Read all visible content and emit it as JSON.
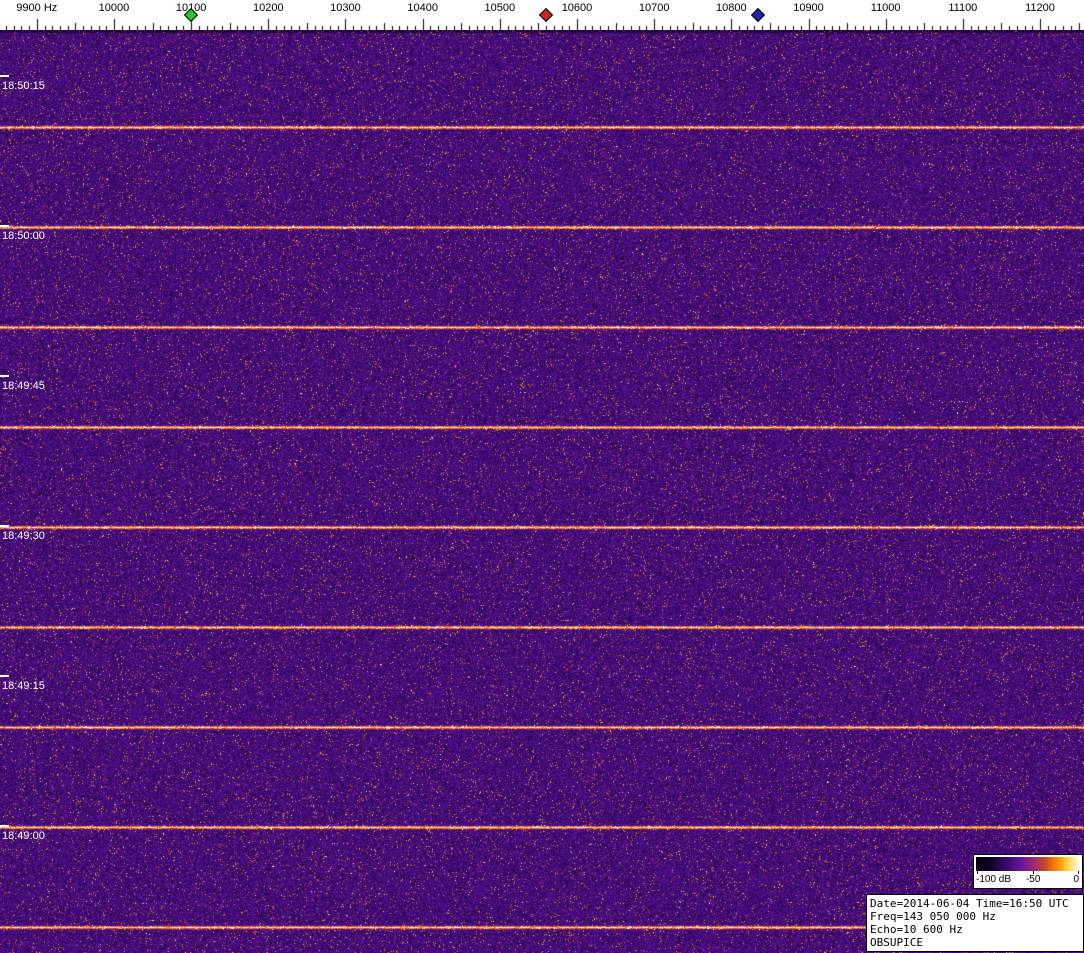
{
  "chart_data": {
    "type": "heatmap",
    "description": "Radio meteor observation waterfall spectrogram: purple broadband noise with bright full-bandwidth pulse lines repeating every 10 seconds",
    "x_axis": {
      "unit": "Hz",
      "tick_labels": [
        "9900 Hz",
        "10000",
        "10100",
        "10200",
        "10300",
        "10400",
        "10500",
        "10600",
        "10700",
        "10800",
        "10900",
        "11000",
        "11100",
        "11200"
      ],
      "tick_freqs": [
        9900,
        10000,
        10100,
        10200,
        10300,
        10400,
        10500,
        10600,
        10700,
        10800,
        10900,
        11000,
        11100,
        11200
      ],
      "minor_tick_step_hz": 10,
      "visible_range_hz": [
        9852,
        11257
      ]
    },
    "y_axis": {
      "unit": "UTC time",
      "direction": "newest-at-top",
      "tick_labels": [
        "18:50:15",
        "18:50:00",
        "18:49:45",
        "18:49:30",
        "18:49:15",
        "18:49:00"
      ],
      "tick_interval_s": 15,
      "visible_range": [
        "18:48:48",
        "18:50:21"
      ]
    },
    "markers": [
      {
        "name": "marker-green",
        "freq_hz": 10100,
        "color": "#22cc22",
        "shape": "diamond"
      },
      {
        "name": "marker-red",
        "freq_hz": 10560,
        "color": "#cc2222",
        "shape": "diamond"
      },
      {
        "name": "marker-blue",
        "freq_hz": 10835,
        "color": "#2222aa",
        "shape": "diamond"
      }
    ],
    "pulses": {
      "period_s": 10,
      "times": [
        "18:50:11",
        "18:50:01",
        "18:49:51",
        "18:49:41",
        "18:49:31",
        "18:49:21",
        "18:49:11",
        "18:49:01",
        "18:48:51"
      ],
      "appearance": "bright orange-white horizontal line across full bandwidth"
    },
    "colorbar": {
      "labels": [
        "-100 dB",
        "-50",
        "0"
      ],
      "min_db": -100,
      "max_db": 0
    },
    "palette": [
      {
        "pos": 0.0,
        "color": "#000000"
      },
      {
        "pos": 0.15,
        "color": "#12022e"
      },
      {
        "pos": 0.3,
        "color": "#3a0a6e"
      },
      {
        "pos": 0.42,
        "color": "#6414a0"
      },
      {
        "pos": 0.55,
        "color": "#962878"
      },
      {
        "pos": 0.66,
        "color": "#c84628"
      },
      {
        "pos": 0.78,
        "color": "#ff8c00"
      },
      {
        "pos": 0.88,
        "color": "#ffd23c"
      },
      {
        "pos": 1.0,
        "color": "#ffffff"
      }
    ],
    "info_box": {
      "lines": [
        "Date=2014-06-04 Time=16:50 UTC",
        "Freq=143 050 000 Hz",
        "Echo=10 600 Hz",
        "OBSUPICE"
      ]
    }
  }
}
